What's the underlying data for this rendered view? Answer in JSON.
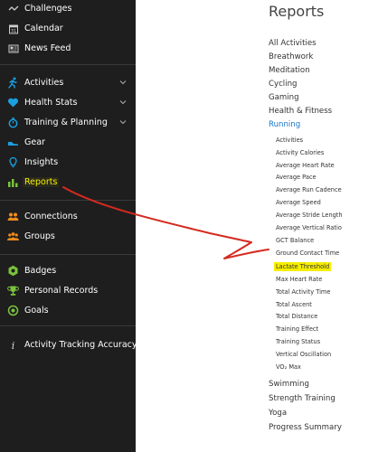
{
  "sidebar": {
    "items": [
      {
        "label": "Challenges",
        "icon": "challenges-icon"
      },
      {
        "label": "Calendar",
        "icon": "calendar-icon"
      },
      {
        "label": "News Feed",
        "icon": "news-feed-icon"
      },
      {
        "label": "Activities",
        "icon": "activities-icon"
      },
      {
        "label": "Health Stats",
        "icon": "heart-icon"
      },
      {
        "label": "Training & Planning",
        "icon": "stopwatch-icon"
      },
      {
        "label": "Gear",
        "icon": "shoe-icon"
      },
      {
        "label": "Insights",
        "icon": "lightbulb-icon"
      },
      {
        "label": "Reports",
        "icon": "bar-chart-icon"
      },
      {
        "label": "Connections",
        "icon": "connections-icon"
      },
      {
        "label": "Groups",
        "icon": "groups-icon"
      },
      {
        "label": "Badges",
        "icon": "badge-icon"
      },
      {
        "label": "Personal Records",
        "icon": "trophy-icon"
      },
      {
        "label": "Goals",
        "icon": "goal-icon"
      },
      {
        "label": "Activity Tracking Accuracy",
        "icon": "info-icon"
      }
    ]
  },
  "main": {
    "title": "Reports",
    "links_top": [
      "All Activities",
      "Breathwork",
      "Meditation",
      "Cycling",
      "Gaming",
      "Health & Fitness",
      "Running"
    ],
    "running_items": [
      "Activities",
      "Activity Calories",
      "Average Heart Rate",
      "Average Pace",
      "Average Run Cadence",
      "Average Speed",
      "Average Stride Length",
      "Average Vertical Ratio",
      "GCT Balance",
      "Ground Contact Time",
      "Lactate Threshold",
      "Max Heart Rate",
      "Total Activity Time",
      "Total Ascent",
      "Total Distance",
      "Training Effect",
      "Training Status",
      "Vertical Oscillation",
      "VO₂ Max"
    ],
    "links_bottom": [
      "Swimming",
      "Strength Training",
      "Yoga",
      "Progress Summary"
    ]
  },
  "colors": {
    "sidebar_bg": "#1e1e1e",
    "active_text": "#f7ee00",
    "link_blue": "#1a73c8",
    "highlight": "#f7ee00",
    "annotation_arrow": "#d42a1f",
    "icon_blue": "#1a9fe0",
    "icon_orange": "#f08c1c",
    "icon_green": "#7ac43c"
  }
}
